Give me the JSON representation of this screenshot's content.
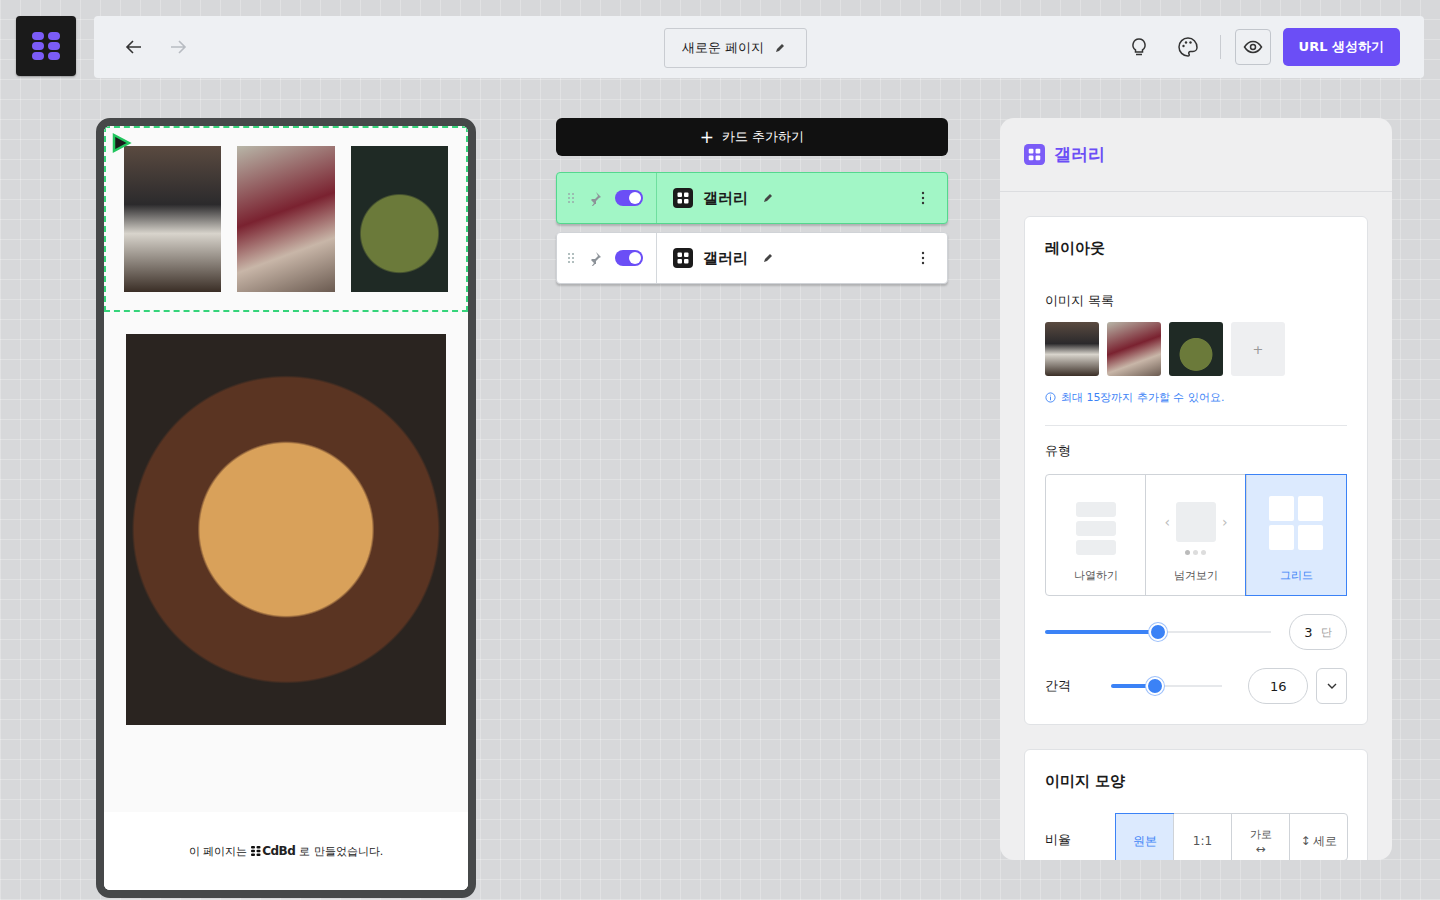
{
  "topbar": {
    "nav": {
      "back_enabled": true,
      "forward_enabled": false
    },
    "page_title": "새로운 페이지",
    "primary_button": "URL 생성하기"
  },
  "preview": {
    "sections": [
      {
        "kind": "grid",
        "selected": true
      },
      {
        "kind": "single",
        "selected": false
      }
    ],
    "footer": {
      "before": "이 페이지는",
      "brand": "CdBd",
      "after": "로 만들었습니다."
    }
  },
  "cards_panel": {
    "add_button": {
      "icon": "+",
      "label": "카드 추가하기"
    },
    "cards": [
      {
        "title": "갤러리",
        "on": true,
        "selected": true
      },
      {
        "title": "갤러리",
        "on": true,
        "selected": false
      }
    ]
  },
  "settings": {
    "title": "갤러리",
    "layout": {
      "title": "레이아웃",
      "images_label": "이미지 목록",
      "add_thumb": "+",
      "info": "최대 15장까지 추가할 수 있어요.",
      "type_label": "유형",
      "types": [
        {
          "label": "나열하기",
          "selected": false,
          "kind": "list"
        },
        {
          "label": "넘겨보기",
          "selected": false,
          "kind": "slide"
        },
        {
          "label": "그리드",
          "selected": true,
          "kind": "grid"
        }
      ],
      "columns": {
        "level": 0.5,
        "value": "3",
        "unit": "단"
      },
      "spacing": {
        "label": "간격",
        "level": 0.4,
        "value": "16"
      }
    },
    "shape": {
      "title": "이미지 모양",
      "ratio_label": "비율",
      "ratios": [
        {
          "label": "원본",
          "icon": "",
          "selected": true
        },
        {
          "label": "1:1",
          "icon": "",
          "selected": false
        },
        {
          "label": "가로",
          "icon": "↔",
          "selected": false
        },
        {
          "label": "세로",
          "icon": "↕",
          "selected": false
        }
      ]
    }
  }
}
